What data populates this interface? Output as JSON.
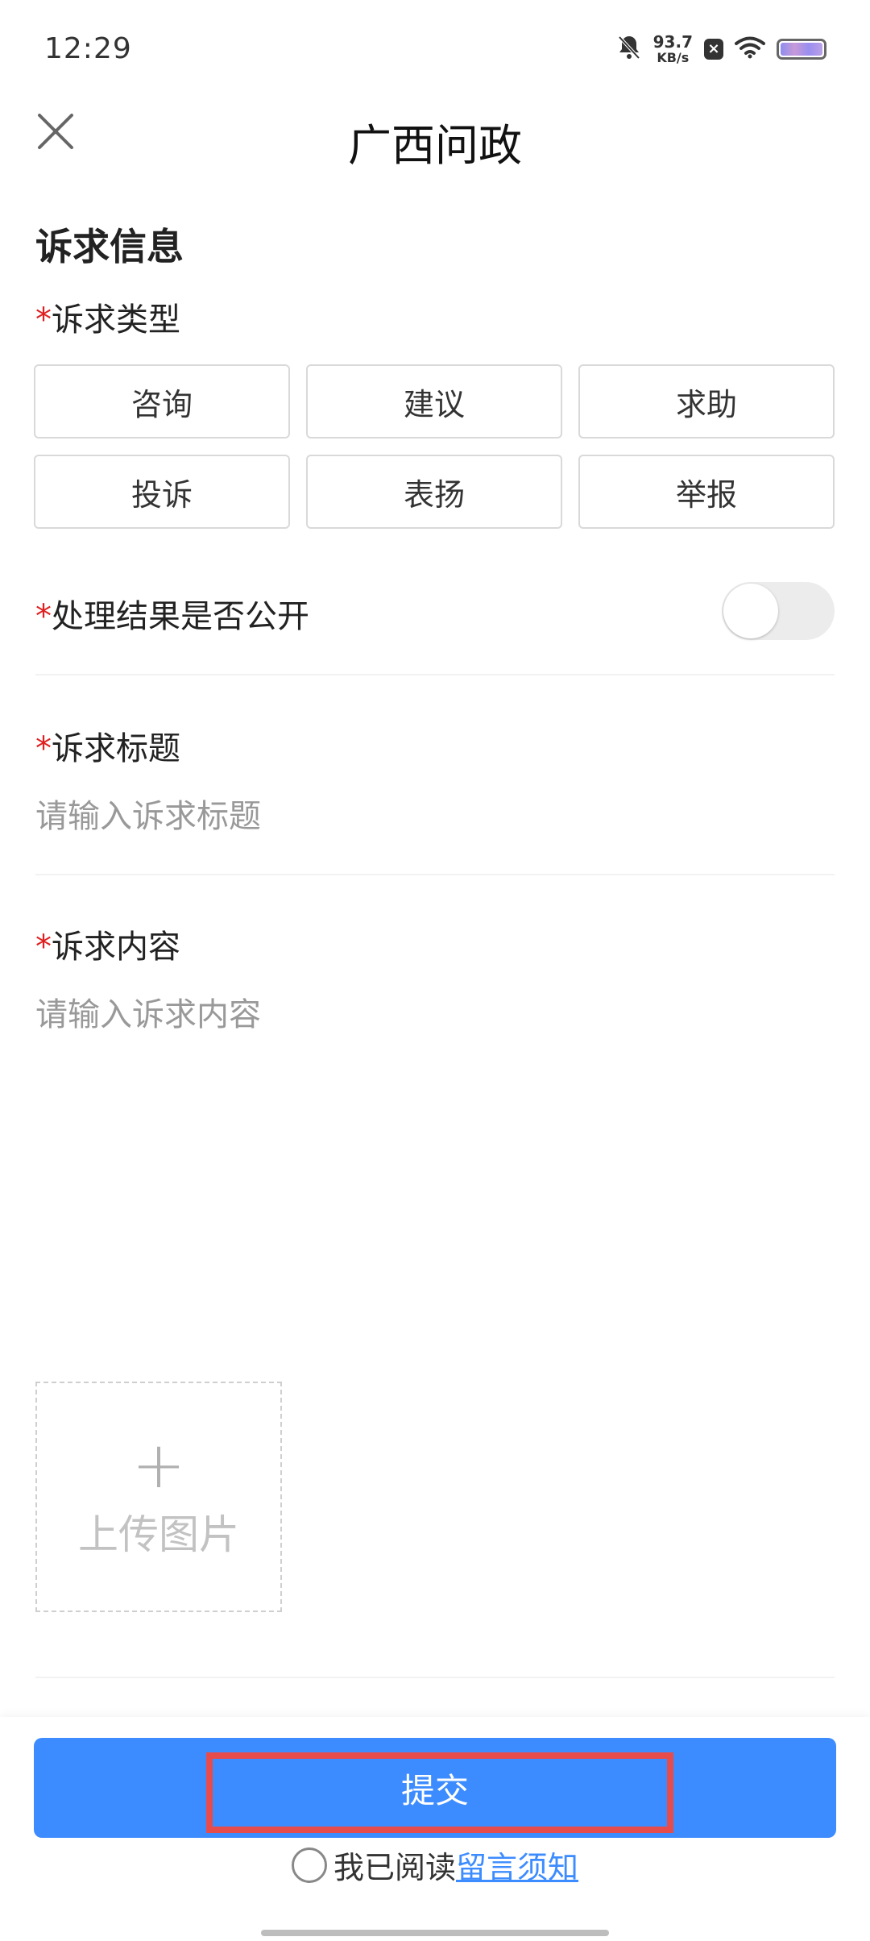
{
  "status_bar": {
    "time": "12:29",
    "speed_value": "93.7",
    "speed_unit": "KB/s"
  },
  "header": {
    "title": "广西问政",
    "close_icon": "close-icon"
  },
  "section": {
    "title": "诉求信息"
  },
  "required_mark": "*",
  "fields": {
    "type_label": "诉求类型",
    "types": [
      "咨询",
      "建议",
      "求助",
      "投诉",
      "表扬",
      "举报"
    ],
    "public_label": "处理结果是否公开",
    "public_value": false,
    "title_label": "诉求标题",
    "title_placeholder": "请输入诉求标题",
    "content_label": "诉求内容",
    "content_placeholder": "请输入诉求内容"
  },
  "upload": {
    "plus": "+",
    "label": "上传图片"
  },
  "footer": {
    "submit_label": "提交",
    "agree_text": "我已阅读",
    "agree_link": "留言须知"
  },
  "colors": {
    "accent": "#3d8cff",
    "required": "#e02020",
    "highlight": "#e74c4c"
  }
}
